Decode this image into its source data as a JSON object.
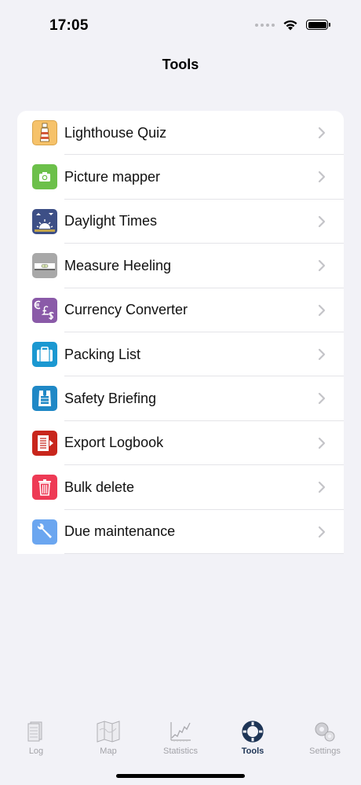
{
  "status_bar": {
    "time": "17:05"
  },
  "nav": {
    "title": "Tools"
  },
  "tools": [
    {
      "label": "Lighthouse Quiz",
      "icon": "lighthouse-icon",
      "color": "#f6c26a"
    },
    {
      "label": "Picture mapper",
      "icon": "camera-icon",
      "color": "#6cc04a"
    },
    {
      "label": "Daylight Times",
      "icon": "sunrise-icon",
      "color": "#3d4f86"
    },
    {
      "label": "Measure Heeling",
      "icon": "level-icon",
      "color": "#a8a8a8"
    },
    {
      "label": "Currency Converter",
      "icon": "currency-icon",
      "color": "#8a5aa8"
    },
    {
      "label": "Packing List",
      "icon": "suitcase-icon",
      "color": "#1b98d1"
    },
    {
      "label": "Safety Briefing",
      "icon": "lifejacket-icon",
      "color": "#1f88c6"
    },
    {
      "label": "Export Logbook",
      "icon": "export-icon",
      "color": "#c8261c"
    },
    {
      "label": "Bulk delete",
      "icon": "trash-icon",
      "color": "#ee3a55"
    },
    {
      "label": "Due maintenance",
      "icon": "wrench-icon",
      "color": "#6ba6f0"
    }
  ],
  "tabbar": {
    "tabs": [
      {
        "label": "Log",
        "icon": "logbook-icon",
        "active": false
      },
      {
        "label": "Map",
        "icon": "map-icon",
        "active": false
      },
      {
        "label": "Statistics",
        "icon": "chart-icon",
        "active": false
      },
      {
        "label": "Tools",
        "icon": "lifebuoy-icon",
        "active": true
      },
      {
        "label": "Settings",
        "icon": "gears-icon",
        "active": false
      }
    ]
  },
  "colors": {
    "active_tab": "#1e3556",
    "inactive_tab": "#a3a3a8",
    "background": "#f2f2f7"
  }
}
